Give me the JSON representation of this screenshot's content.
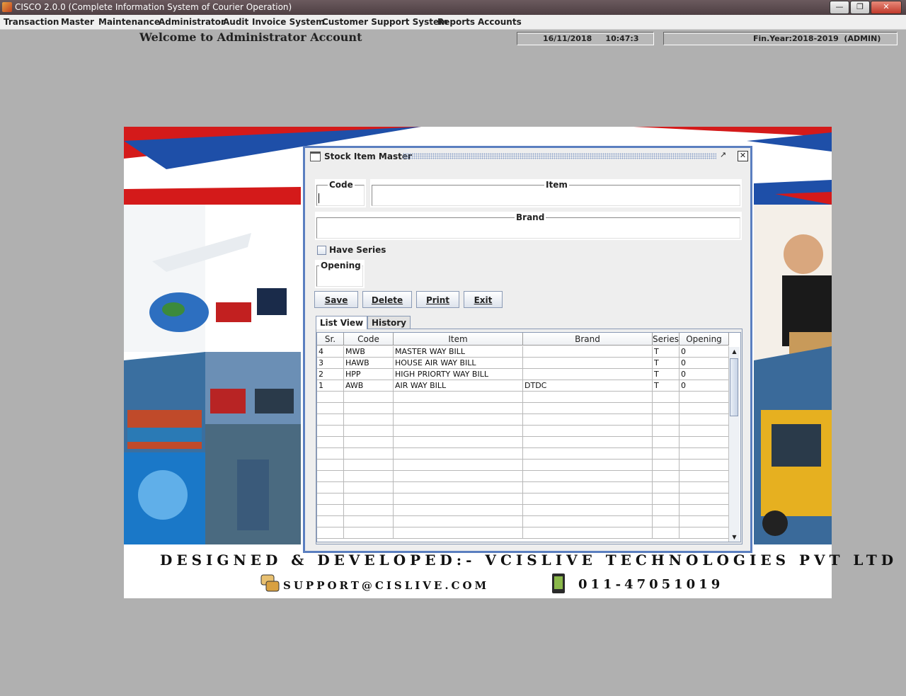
{
  "window": {
    "title": "CISCO 2.0.0 (Complete Information System of Courier Operation)",
    "minimize_icon": "minimize-icon",
    "restore_icon": "restore-icon",
    "close_icon": "close-icon"
  },
  "menu": [
    "Transaction",
    "Master",
    "Maintenance",
    "Administrator",
    "Audit",
    "Invoice System",
    "Customer Support System",
    "Reports",
    "Accounts"
  ],
  "header": {
    "welcome": "Welcome to Administrator Account",
    "datetime": "16/11/2018     10:47:3",
    "finyear": "Fin.Year:2018-2019  (ADMIN)"
  },
  "banner": {
    "designed_by": "DESIGNED & DEVELOPED:- VCISLIVE TECHNOLOGIES PVT LTD",
    "support_email": "SUPPORT@CISLIVE.COM",
    "phone": "011-47051019"
  },
  "dialog": {
    "title": "Stock Item Master",
    "fields": {
      "code_label": "Code",
      "code_value": "",
      "item_label": "Item",
      "item_value": "",
      "brand_label": "Brand",
      "brand_value": "",
      "opening_label": "Opening",
      "opening_value": ""
    },
    "have_series_label": "Have Series",
    "have_series_checked": false,
    "buttons": {
      "save": "Save",
      "delete": "Delete",
      "print": "Print",
      "exit": "Exit"
    },
    "tabs": [
      "List View",
      "History"
    ],
    "active_tab": "List View",
    "table": {
      "columns": [
        "Sr.",
        "Code",
        "Item",
        "Brand",
        "Series",
        "Opening"
      ],
      "rows": [
        [
          "4",
          "MWB",
          "MASTER WAY BILL",
          "",
          "T",
          "0"
        ],
        [
          "3",
          "HAWB",
          "HOUSE AIR WAY BILL",
          "",
          "T",
          "0"
        ],
        [
          "2",
          "HPP",
          "HIGH PRIORTY WAY BILL",
          "",
          "T",
          "0"
        ],
        [
          "1",
          "AWB",
          "AIR WAY BILL",
          "DTDC",
          "T",
          "0"
        ]
      ]
    }
  }
}
